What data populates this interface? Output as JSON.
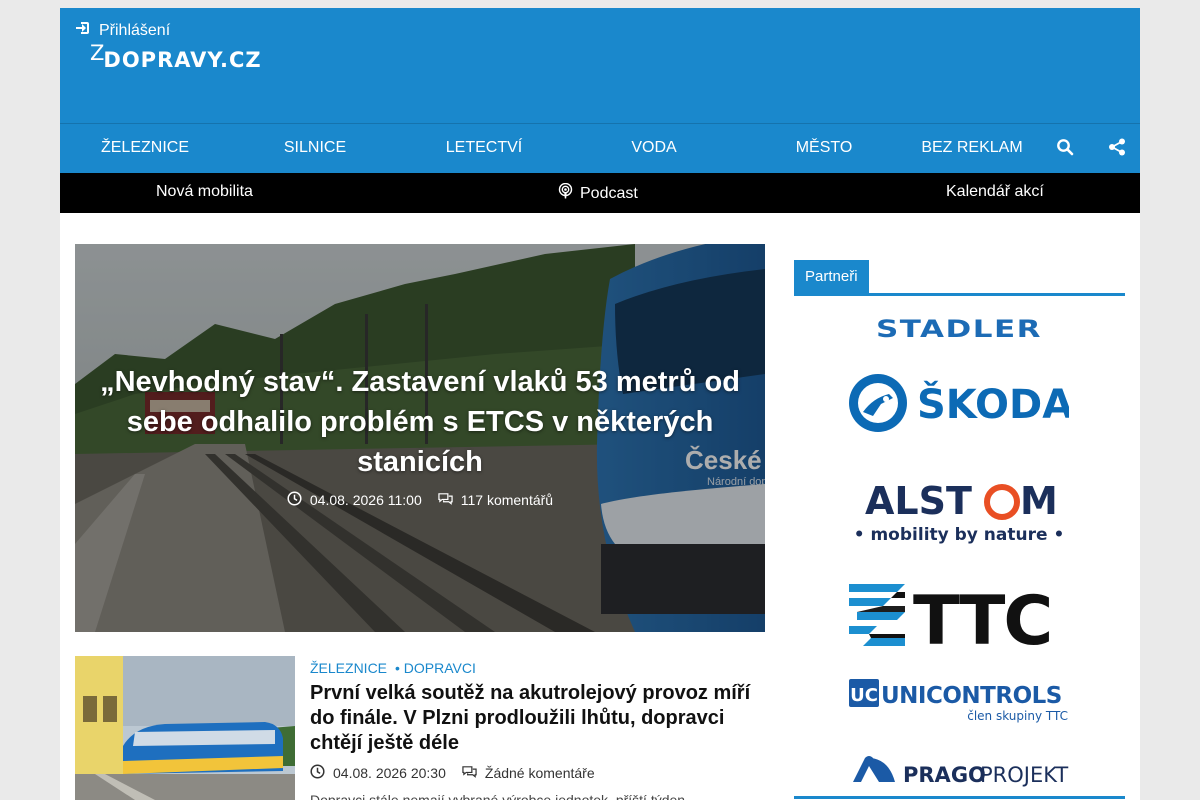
{
  "header": {
    "login_label": "Přihlášení",
    "logo_text": "DOPRAVY.CZ",
    "logo_mark": "Z"
  },
  "nav": {
    "items": [
      "ŽELEZNICE",
      "SILNICE",
      "LETECTVÍ",
      "VODA",
      "MĚSTO",
      "BEZ REKLAM"
    ],
    "icons": [
      "search-icon",
      "share-icon"
    ]
  },
  "subnav": {
    "items": [
      "Nová mobilita",
      "Podcast",
      "Kalendář akcí"
    ]
  },
  "hero": {
    "title": "„Nevhodný stav“. Zastavení vlaků 53 metrů od sebe odhalilo problém s ETCS v některých stanicích",
    "date": "04.08. 2026 11:00",
    "comments": "117 komentářů",
    "train_text": "České",
    "train_subtext": "Národní dop"
  },
  "article2": {
    "categories": [
      "ŽELEZNICE",
      "• DOPRAVCI"
    ],
    "title": "První velká soutěž na akutrolejový provoz míří do finále. V Plzni prodloužili lhůtu, dopravci chtějí ještě déle",
    "date": "04.08. 2026 20:30",
    "comments": "Žádné komentáře",
    "excerpt": "Dopravci stále nemají vybrané výrobce jednotek, příští týden..."
  },
  "sidebar": {
    "tab_label": "Partneři",
    "partners": {
      "stadler": "STADLER",
      "skoda": "ŠKODA",
      "alstom_a": "ALST",
      "alstom_b": "M",
      "alstom_tag": "• mobility by nature •",
      "ttc": "TTC",
      "unicontrols_uc": "UC",
      "unicontrols_name": "UNICONTROLS",
      "unicontrols_tag": "člen skupiny TTC",
      "prago_a": "PRAGO",
      "prago_b": "PROJEKT"
    }
  },
  "colors": {
    "brand_blue": "#1a88cc",
    "subnav_bg": "#000000"
  }
}
